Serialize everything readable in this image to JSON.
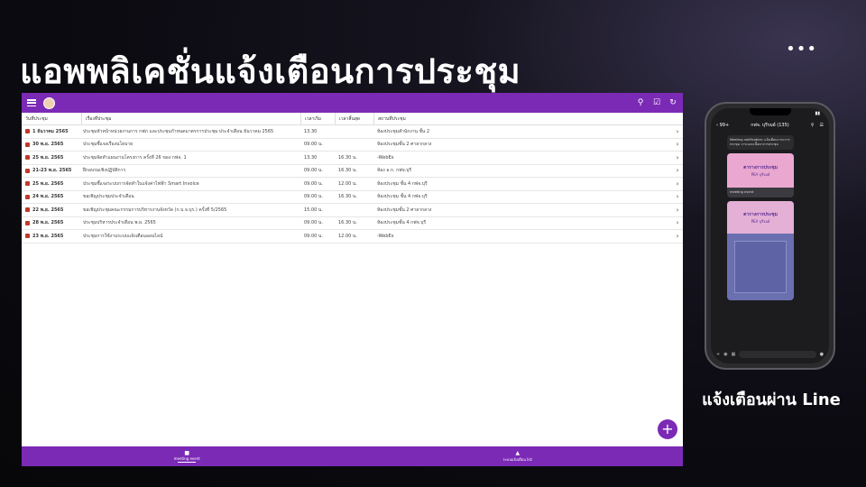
{
  "slide": {
    "title": "แอพพลิเคชั่นแจ้งเตือนการประชุม",
    "more": "•••",
    "phone_caption": "แจ้งเตือนผ่าน Line"
  },
  "app": {
    "columns": {
      "date": "วันที่ประชุม",
      "subject": "เรื่องที่ประชุม",
      "start": "เวลาเริ่ม",
      "end": "เวลาสิ้นสุด",
      "location": "สถานที่ประชุม"
    },
    "rows": [
      {
        "date": "1 ธันวาคม 2565",
        "subject": "ประชุมหัวหน้าหน่วยงานการ กฟภ และประชุมกำหนดมาตรการประชุม ประจำเดือน ธันวาคม 2565",
        "start": "13.30",
        "end": "",
        "location": "ห้องประชุมสำนักงาน ชั้น 2"
      },
      {
        "date": "30 พ.ย. 2565",
        "subject": "ประชุมชี้แจงเรื่องนโยบาย",
        "start": "09.00 น.",
        "end": "",
        "location": "ห้องประชุมชั้น 2 ศาลากลาง"
      },
      {
        "date": "25 พ.ย. 2565",
        "subject": "ประชุมจัดทำแผนงานโครงการ ครั้งที่ 26 ของ กฟจ. 1",
        "start": "13.30",
        "end": "16.30 น.",
        "location": "-WebEx"
      },
      {
        "date": "21-23 พ.ย. 2565",
        "subject": "ฝึกอบรมเชิงปฏิบัติการ",
        "start": "09.00 น.",
        "end": "16.30 น.",
        "location": "ห้อง อ.ก. กฟจ.บุรี"
      },
      {
        "date": "25 พ.ย. 2565",
        "subject": "ประชุมชี้แจงระบบการจัดทำใบแจ้งค่าไฟฟ้า Smart Invoice",
        "start": "09.00 น.",
        "end": "12.00 น.",
        "location": "ห้องประชุม ชั้น 4 กฟจ.บุรี"
      },
      {
        "date": "24 พ.ย. 2565",
        "subject": "ขอเชิญประชุมประจำเดือน",
        "start": "09.00 น.",
        "end": "16.30 น.",
        "location": "ห้องประชุม ชั้น 4 กฟจ.บุรี"
      },
      {
        "date": "22 พ.ย. 2565",
        "subject": "ขอเชิญประชุมคณะกรรมการบริหารงานจังหวัด (ก.บ.จ.บุร.) ครั้งที่ 5/2565",
        "start": "15.00 น.",
        "end": "",
        "location": "ห้องประชุมชั้น 2 ศาลากลาง"
      },
      {
        "date": "28 พ.ย. 2565",
        "subject": "ประชุมบริหารประจำเดือน พ.ย. 2565",
        "start": "09.00 น.",
        "end": "16.30 น.",
        "location": "ห้องประชุมชั้น 4 กฟจ.บุรี"
      },
      {
        "date": "23 พ.ย. 2565",
        "subject": "ประชุมการใช้งานระบบแจ้งเตือนออนไลน์",
        "start": "09.00 น.",
        "end": "12.00 น.",
        "location": "-WebEx"
      }
    ],
    "fab": "+",
    "nav": [
      {
        "label": "meeting event"
      },
      {
        "label": "ระบบแจ้งเตือน list"
      }
    ]
  },
  "phone": {
    "time": "",
    "back": "‹ 99+",
    "chat_name": "กฟจ. บุรีรมย์ (135)",
    "notification_text": "Meeting notification: แจ้งเตือนวาระการประชุม วาระและเนื้อหาการประชุม",
    "card1_title": "ตารางการประชุม",
    "card1_sub": "PEA บุรีรมย์",
    "card1_caption": "meeting event",
    "card2_title": "ตารางการประชุม",
    "card2_sub": "PEA บุรีรมย์"
  }
}
